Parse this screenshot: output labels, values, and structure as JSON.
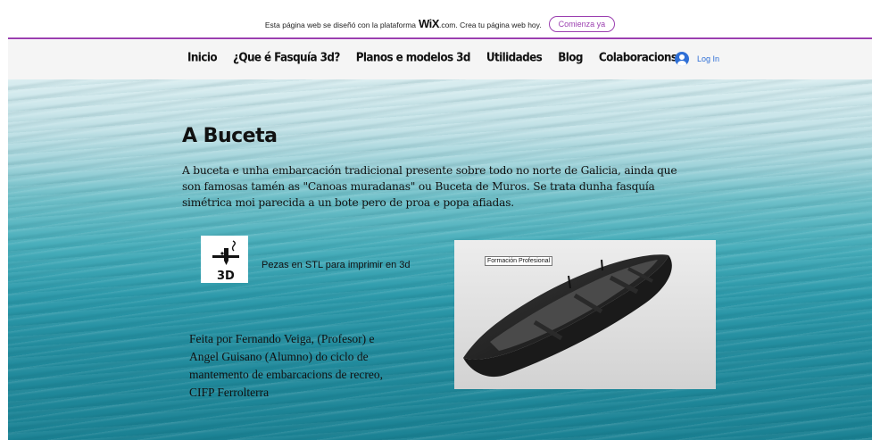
{
  "wix_banner": {
    "text_before": "Esta página web se diseñó con la plataforma",
    "brand": "WiX",
    "text_after": ".com. Crea tu página web hoy.",
    "cta_label": "Comienza ya"
  },
  "nav": {
    "items": [
      "Inicio",
      "¿Que é Fasquía 3d?",
      "Planos e modelos 3d",
      "Utilidades",
      "Blog",
      "Colaboracions"
    ],
    "login_label": "Log In"
  },
  "main": {
    "title": "A Buceta",
    "intro": "A buceta e unha embarcación tradicional presente sobre todo no norte de Galicia, ainda que son famosas tamén as \"Canoas muradanas\" ou Buceta de Muros. Se trata dunha fasquía simétrica moi parecida a un bote pero de proa e popa afiadas.",
    "stl_icon_text": "3D",
    "stl_label": "Pezas en STL para imprimir en 3d",
    "credits": "Feita por Fernando Veiga, (Profesor) e Angel Guisano (Alumno) do ciclo de mantemento de embarcacions de recreo, CIFP Ferrolterra",
    "boat_image_tag": "Formación Profesional"
  },
  "colors": {
    "accent": "#9b3fb0",
    "login": "#2f6fd6",
    "nav_bg": "#f5f5f5"
  }
}
